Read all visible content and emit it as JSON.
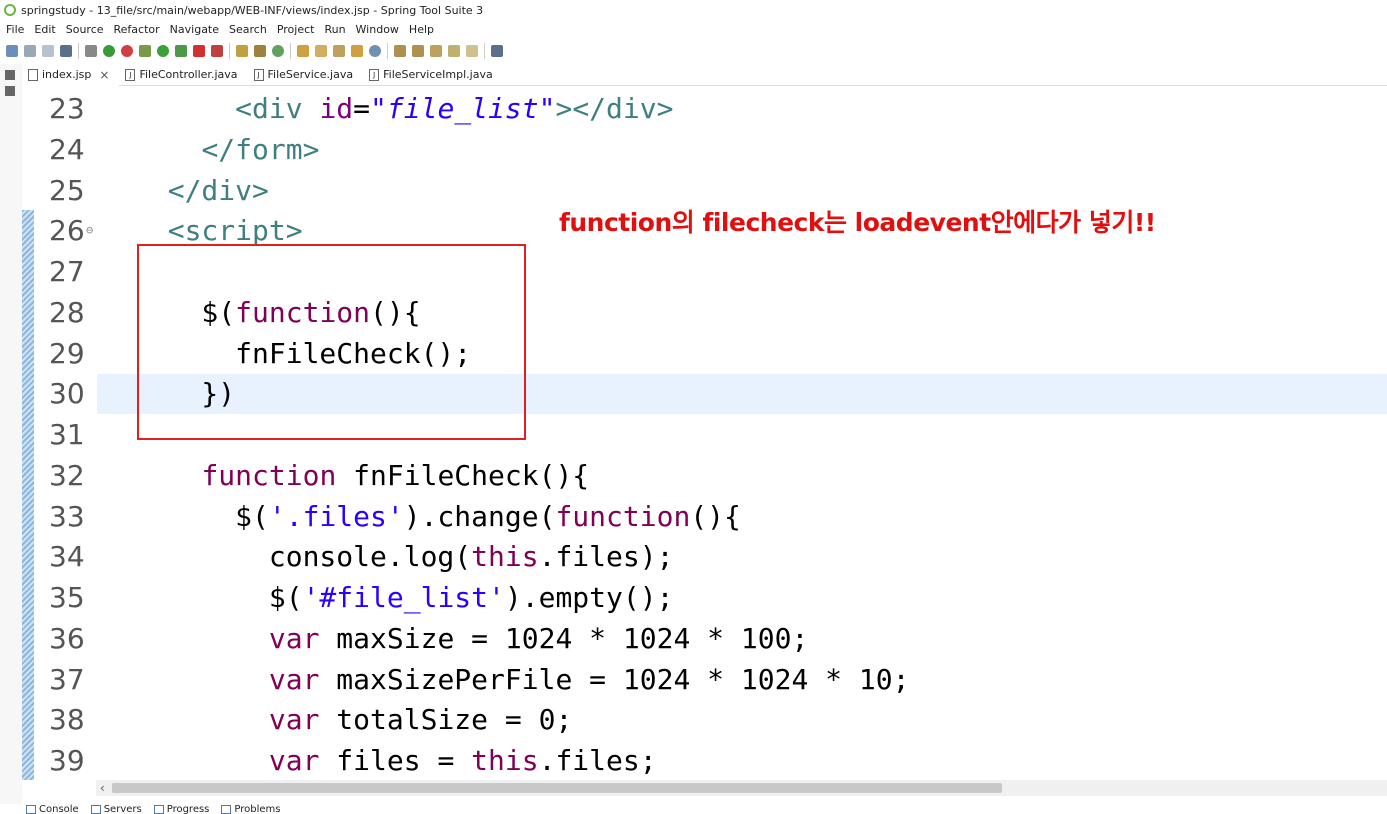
{
  "window": {
    "title": "springstudy - 13_file/src/main/webapp/WEB-INF/views/index.jsp - Spring Tool Suite 3"
  },
  "menu": [
    "File",
    "Edit",
    "Source",
    "Refactor",
    "Navigate",
    "Search",
    "Project",
    "Run",
    "Window",
    "Help"
  ],
  "tabs": [
    {
      "label": "index.jsp",
      "active": true,
      "closable": true
    },
    {
      "label": "FileController.java",
      "active": false
    },
    {
      "label": "FileService.java",
      "active": false
    },
    {
      "label": "FileServiceImpl.java",
      "active": false
    }
  ],
  "editor": {
    "current_line": "30",
    "lines": [
      {
        "num": "23",
        "text": "      <div id=\"file_list\"></div>"
      },
      {
        "num": "24",
        "text": "    </form>"
      },
      {
        "num": "25",
        "text": "  </div>"
      },
      {
        "num": "26",
        "text": "  <script>"
      },
      {
        "num": "27",
        "text": ""
      },
      {
        "num": "28",
        "text": "    $(function(){"
      },
      {
        "num": "29",
        "text": "      fnFileCheck();"
      },
      {
        "num": "30",
        "text": "    })"
      },
      {
        "num": "31",
        "text": ""
      },
      {
        "num": "32",
        "text": "    function fnFileCheck(){"
      },
      {
        "num": "33",
        "text": "      $('.files').change(function(){"
      },
      {
        "num": "34",
        "text": "        console.log(this.files);"
      },
      {
        "num": "35",
        "text": "        $('#file_list').empty();"
      },
      {
        "num": "36",
        "text": "        var maxSize = 1024 * 1024 * 100;"
      },
      {
        "num": "37",
        "text": "        var maxSizePerFile = 1024 * 1024 * 10;"
      },
      {
        "num": "38",
        "text": "        var totalSize = 0;"
      },
      {
        "num": "39",
        "text": "        var files = this.files;"
      }
    ]
  },
  "annotation": {
    "text": "function의 filecheck는 loadevent안에다가 넣기!!",
    "color": "#e01010"
  },
  "bottom_tabs": [
    "Console",
    "Servers",
    "Progress",
    "Problems"
  ],
  "colors": {
    "tag": "#3f7f7f",
    "attribute": "#7f007f",
    "keyword": "#7f0055",
    "string": "#2a00ff",
    "highlight_box": "#e02020"
  }
}
